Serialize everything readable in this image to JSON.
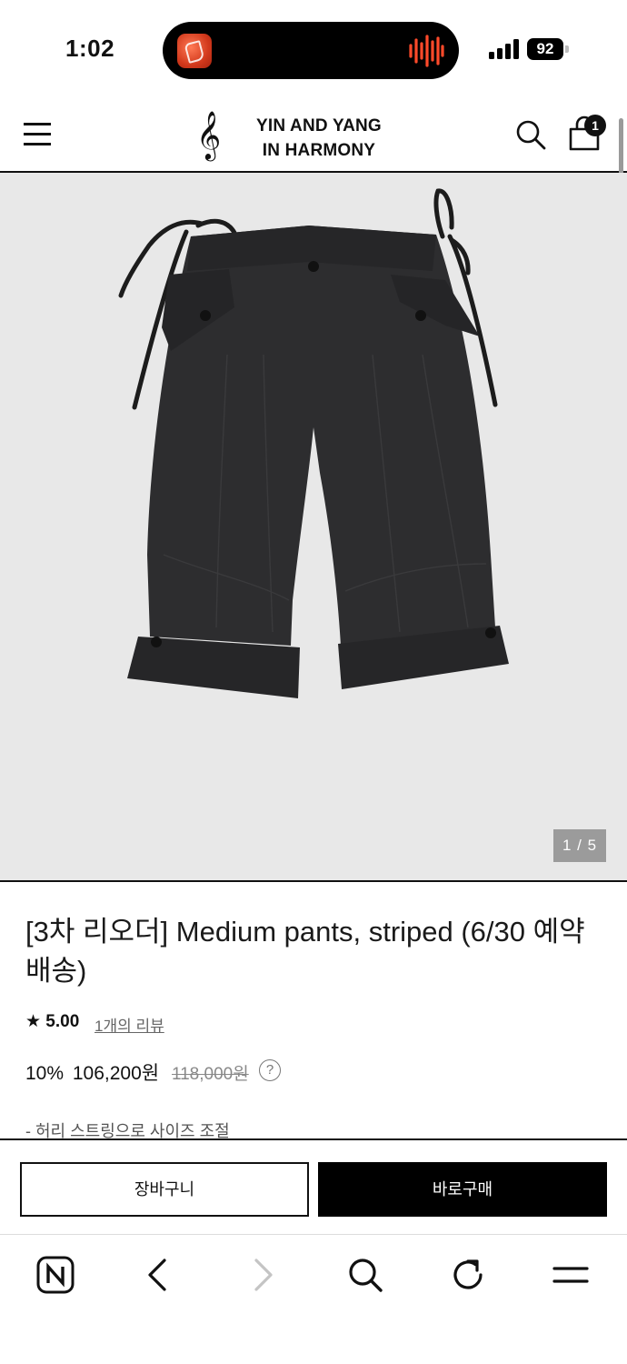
{
  "status_bar": {
    "time": "1:02",
    "battery": "92"
  },
  "header": {
    "logo_line1": "YIN AND YANG",
    "logo_line2": "IN HARMONY",
    "logo_mark": "𝄞",
    "cart_count": "1"
  },
  "gallery": {
    "counter": "1 / 5"
  },
  "product": {
    "title": "[3차 리오더] Medium pants, striped (6/30 예약배송)",
    "rating": "★ 5.00",
    "review_link": "1개의 리뷰",
    "discount": "10%",
    "sale_price": "106,200원",
    "original_price": "118,000원",
    "help": "?",
    "description": "- 허리 스트링으로 사이즈 조절"
  },
  "actions": {
    "cart_label": "장바구니",
    "buy_label": "바로구매"
  },
  "browser_toolbar": {
    "icons": [
      "naver-icon",
      "back-icon",
      "forward-icon",
      "search-icon",
      "refresh-icon",
      "menu-icon"
    ]
  }
}
